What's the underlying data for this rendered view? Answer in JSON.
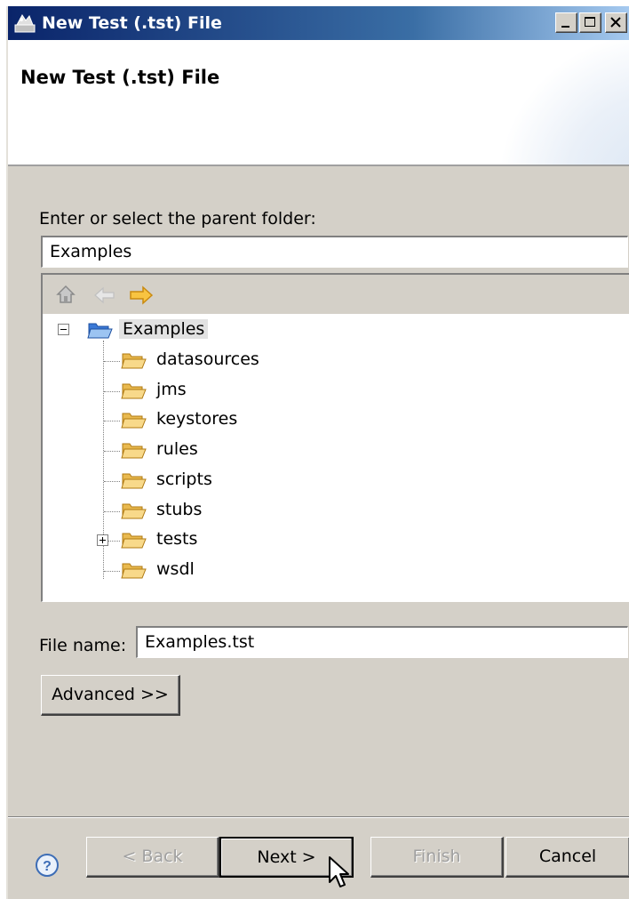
{
  "window": {
    "title": "New Test (.tst) File",
    "controls": [
      "minimize",
      "maximize",
      "close"
    ]
  },
  "banner": {
    "title": "New Test (.tst) File"
  },
  "folder_section": {
    "label": "Enter or select the parent folder:",
    "value": "Examples"
  },
  "tree_toolbar": {
    "icons": [
      "home-icon",
      "back-arrow-icon",
      "forward-arrow-icon"
    ]
  },
  "tree": {
    "root": "Examples",
    "children": [
      "datasources",
      "jms",
      "keystores",
      "rules",
      "scripts",
      "stubs",
      "tests",
      "wsdl"
    ]
  },
  "file_name": {
    "label": "File name:",
    "value": "Examples.tst"
  },
  "advanced_label": "Advanced >>",
  "buttons": {
    "back": "< Back",
    "next": "Next >",
    "finish": "Finish",
    "cancel": "Cancel"
  },
  "colors": {
    "titlebar": "#0a246a",
    "dialog_bg": "#d4d0c8",
    "folder_fill": "#f5d27a"
  }
}
